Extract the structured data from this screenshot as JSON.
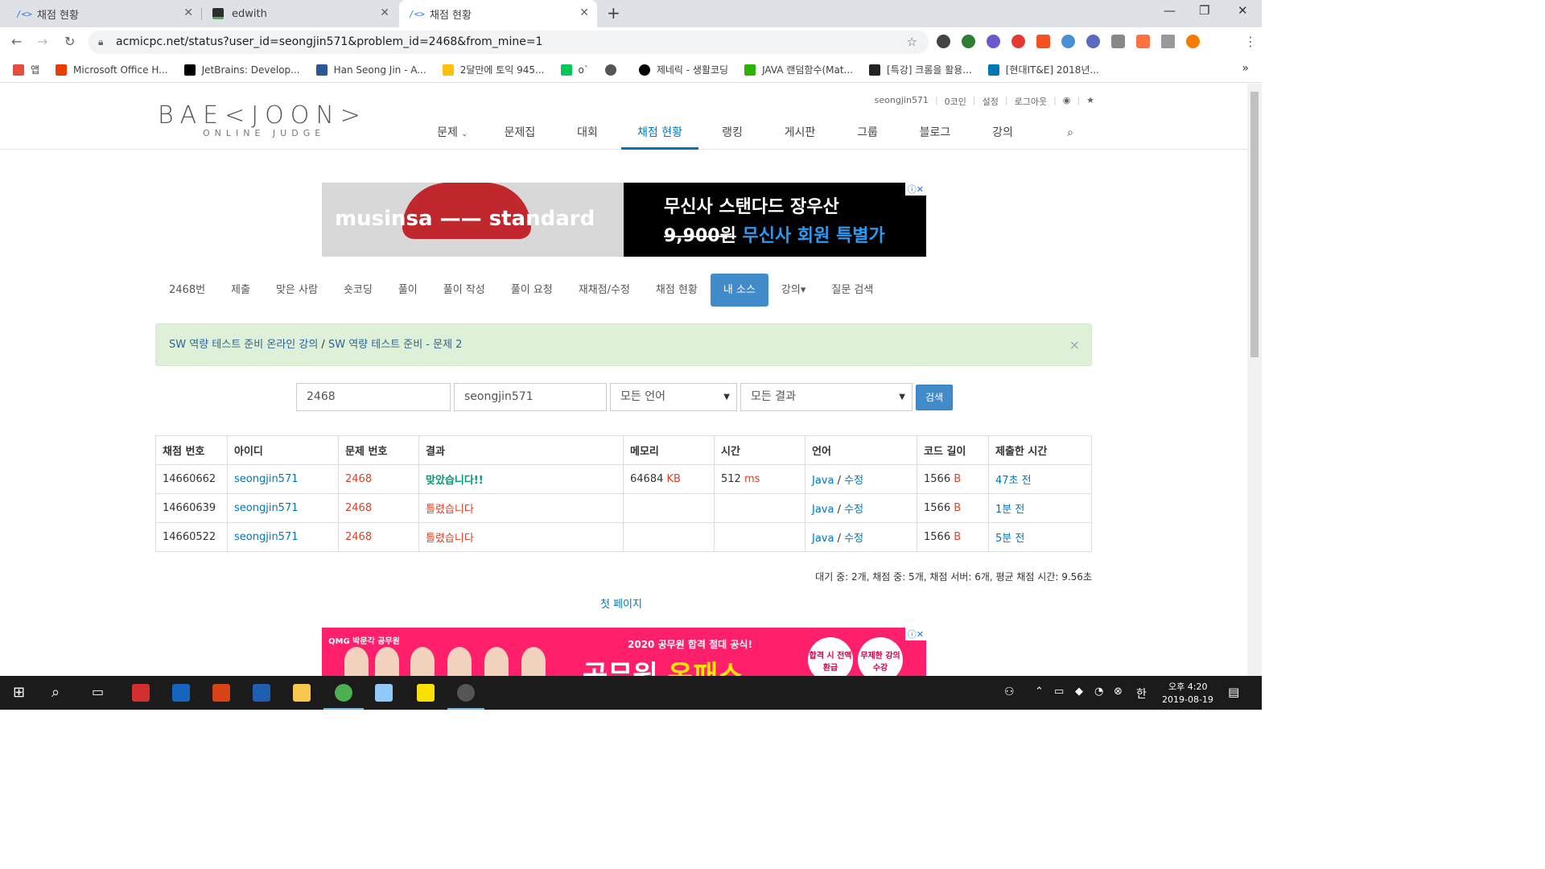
{
  "browser": {
    "tabs": [
      {
        "title": "채점 현황",
        "active": false
      },
      {
        "title": "edwith",
        "active": false
      },
      {
        "title": "채점 현황",
        "active": true
      }
    ],
    "url": "acmicpc.net/status?user_id=seongjin571&problem_id=2468&from_mine=1",
    "bookmarks": [
      "앱",
      "Microsoft Office H...",
      "JetBrains: Develop...",
      "Han Seong Jin - A...",
      "2달만에 토익 945...",
      "o`",
      "제네릭 - 생활코딩",
      "JAVA 랜덤함수(Mat...",
      "[특강] 크롬을 활용...",
      "[현대IT&E] 2018년..."
    ]
  },
  "site": {
    "logo": "BAE<JOON>",
    "logo_sub": "ONLINE JUDGE",
    "user": {
      "name": "seongjin571",
      "coins": "0코인",
      "settings": "설정",
      "logout": "로그아웃"
    },
    "nav": [
      "문제",
      "문제집",
      "대회",
      "채점 현황",
      "랭킹",
      "게시판",
      "그룹",
      "블로그",
      "강의"
    ],
    "nav_active": "채점 현황"
  },
  "ad_top": {
    "brand_left": "musinsa",
    "brand_right": "standard",
    "line1": "무신사 스탠다드 장우산",
    "price_old": "9,900원",
    "price_new": "무신사 회원 특별가"
  },
  "subnav": [
    "2468번",
    "제출",
    "맞은 사람",
    "숏코딩",
    "풀이",
    "풀이 작성",
    "풀이 요청",
    "재채점/수정",
    "채점 현황",
    "내 소스",
    "강의▾",
    "질문 검색"
  ],
  "subnav_active": "내 소스",
  "alert": {
    "link1": "SW 역량 테스트 준비 온라인 강의",
    "sep": " / ",
    "link2": "SW 역량 테스트 준비 - 문제 2"
  },
  "filters": {
    "problem_id": "2468",
    "user_id": "seongjin571",
    "language": "모든 언어",
    "result": "모든 결과",
    "search_button": "검색"
  },
  "table": {
    "headers": [
      "채점 번호",
      "아이디",
      "문제 번호",
      "결과",
      "메모리",
      "시간",
      "언어",
      "코드 길이",
      "제출한 시간"
    ],
    "rows": [
      {
        "id": "14660662",
        "user": "seongjin571",
        "problem": "2468",
        "result": "맞았습니다!!",
        "result_ok": true,
        "memory": "64684",
        "memory_unit": "KB",
        "time": "512",
        "time_unit": "ms",
        "lang": "Java",
        "edit": "수정",
        "len": "1566",
        "len_unit": "B",
        "submitted": "47초 전"
      },
      {
        "id": "14660639",
        "user": "seongjin571",
        "problem": "2468",
        "result": "틀렸습니다",
        "result_ok": false,
        "memory": "",
        "memory_unit": "",
        "time": "",
        "time_unit": "",
        "lang": "Java",
        "edit": "수정",
        "len": "1566",
        "len_unit": "B",
        "submitted": "1분 전"
      },
      {
        "id": "14660522",
        "user": "seongjin571",
        "problem": "2468",
        "result": "틀렸습니다",
        "result_ok": false,
        "memory": "",
        "memory_unit": "",
        "time": "",
        "time_unit": "",
        "lang": "Java",
        "edit": "수정",
        "len": "1566",
        "len_unit": "B",
        "submitted": "5분 전"
      }
    ]
  },
  "stats": "대기 중: 2개, 채점 중: 5개, 채점 서버: 6개, 평균 채점 시간: 9.56초",
  "first_page": "첫 페이지",
  "ad_bottom": {
    "brand": "QMG 박문각 공무원",
    "headline": "2020 공무원 합격 절대 공식!",
    "big_white": "공무원 ",
    "big_yellow": "온패스",
    "badge1": "합격 시 전액 환급",
    "badge2": "무제한 강의 수강"
  },
  "taskbar": {
    "ampm_time": "오후 4:20",
    "date": "2019-08-19",
    "ime": "한"
  }
}
